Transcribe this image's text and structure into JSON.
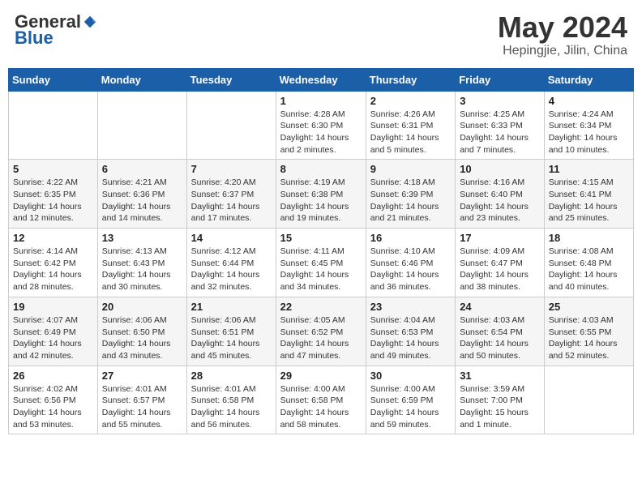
{
  "header": {
    "logo_general": "General",
    "logo_blue": "Blue",
    "month_year": "May 2024",
    "location": "Hepingjie, Jilin, China"
  },
  "days_of_week": [
    "Sunday",
    "Monday",
    "Tuesday",
    "Wednesday",
    "Thursday",
    "Friday",
    "Saturday"
  ],
  "weeks": [
    [
      {
        "day": "",
        "info": ""
      },
      {
        "day": "",
        "info": ""
      },
      {
        "day": "",
        "info": ""
      },
      {
        "day": "1",
        "info": "Sunrise: 4:28 AM\nSunset: 6:30 PM\nDaylight: 14 hours\nand 2 minutes."
      },
      {
        "day": "2",
        "info": "Sunrise: 4:26 AM\nSunset: 6:31 PM\nDaylight: 14 hours\nand 5 minutes."
      },
      {
        "day": "3",
        "info": "Sunrise: 4:25 AM\nSunset: 6:33 PM\nDaylight: 14 hours\nand 7 minutes."
      },
      {
        "day": "4",
        "info": "Sunrise: 4:24 AM\nSunset: 6:34 PM\nDaylight: 14 hours\nand 10 minutes."
      }
    ],
    [
      {
        "day": "5",
        "info": "Sunrise: 4:22 AM\nSunset: 6:35 PM\nDaylight: 14 hours\nand 12 minutes."
      },
      {
        "day": "6",
        "info": "Sunrise: 4:21 AM\nSunset: 6:36 PM\nDaylight: 14 hours\nand 14 minutes."
      },
      {
        "day": "7",
        "info": "Sunrise: 4:20 AM\nSunset: 6:37 PM\nDaylight: 14 hours\nand 17 minutes."
      },
      {
        "day": "8",
        "info": "Sunrise: 4:19 AM\nSunset: 6:38 PM\nDaylight: 14 hours\nand 19 minutes."
      },
      {
        "day": "9",
        "info": "Sunrise: 4:18 AM\nSunset: 6:39 PM\nDaylight: 14 hours\nand 21 minutes."
      },
      {
        "day": "10",
        "info": "Sunrise: 4:16 AM\nSunset: 6:40 PM\nDaylight: 14 hours\nand 23 minutes."
      },
      {
        "day": "11",
        "info": "Sunrise: 4:15 AM\nSunset: 6:41 PM\nDaylight: 14 hours\nand 25 minutes."
      }
    ],
    [
      {
        "day": "12",
        "info": "Sunrise: 4:14 AM\nSunset: 6:42 PM\nDaylight: 14 hours\nand 28 minutes."
      },
      {
        "day": "13",
        "info": "Sunrise: 4:13 AM\nSunset: 6:43 PM\nDaylight: 14 hours\nand 30 minutes."
      },
      {
        "day": "14",
        "info": "Sunrise: 4:12 AM\nSunset: 6:44 PM\nDaylight: 14 hours\nand 32 minutes."
      },
      {
        "day": "15",
        "info": "Sunrise: 4:11 AM\nSunset: 6:45 PM\nDaylight: 14 hours\nand 34 minutes."
      },
      {
        "day": "16",
        "info": "Sunrise: 4:10 AM\nSunset: 6:46 PM\nDaylight: 14 hours\nand 36 minutes."
      },
      {
        "day": "17",
        "info": "Sunrise: 4:09 AM\nSunset: 6:47 PM\nDaylight: 14 hours\nand 38 minutes."
      },
      {
        "day": "18",
        "info": "Sunrise: 4:08 AM\nSunset: 6:48 PM\nDaylight: 14 hours\nand 40 minutes."
      }
    ],
    [
      {
        "day": "19",
        "info": "Sunrise: 4:07 AM\nSunset: 6:49 PM\nDaylight: 14 hours\nand 42 minutes."
      },
      {
        "day": "20",
        "info": "Sunrise: 4:06 AM\nSunset: 6:50 PM\nDaylight: 14 hours\nand 43 minutes."
      },
      {
        "day": "21",
        "info": "Sunrise: 4:06 AM\nSunset: 6:51 PM\nDaylight: 14 hours\nand 45 minutes."
      },
      {
        "day": "22",
        "info": "Sunrise: 4:05 AM\nSunset: 6:52 PM\nDaylight: 14 hours\nand 47 minutes."
      },
      {
        "day": "23",
        "info": "Sunrise: 4:04 AM\nSunset: 6:53 PM\nDaylight: 14 hours\nand 49 minutes."
      },
      {
        "day": "24",
        "info": "Sunrise: 4:03 AM\nSunset: 6:54 PM\nDaylight: 14 hours\nand 50 minutes."
      },
      {
        "day": "25",
        "info": "Sunrise: 4:03 AM\nSunset: 6:55 PM\nDaylight: 14 hours\nand 52 minutes."
      }
    ],
    [
      {
        "day": "26",
        "info": "Sunrise: 4:02 AM\nSunset: 6:56 PM\nDaylight: 14 hours\nand 53 minutes."
      },
      {
        "day": "27",
        "info": "Sunrise: 4:01 AM\nSunset: 6:57 PM\nDaylight: 14 hours\nand 55 minutes."
      },
      {
        "day": "28",
        "info": "Sunrise: 4:01 AM\nSunset: 6:58 PM\nDaylight: 14 hours\nand 56 minutes."
      },
      {
        "day": "29",
        "info": "Sunrise: 4:00 AM\nSunset: 6:58 PM\nDaylight: 14 hours\nand 58 minutes."
      },
      {
        "day": "30",
        "info": "Sunrise: 4:00 AM\nSunset: 6:59 PM\nDaylight: 14 hours\nand 59 minutes."
      },
      {
        "day": "31",
        "info": "Sunrise: 3:59 AM\nSunset: 7:00 PM\nDaylight: 15 hours\nand 1 minute."
      },
      {
        "day": "",
        "info": ""
      }
    ]
  ]
}
